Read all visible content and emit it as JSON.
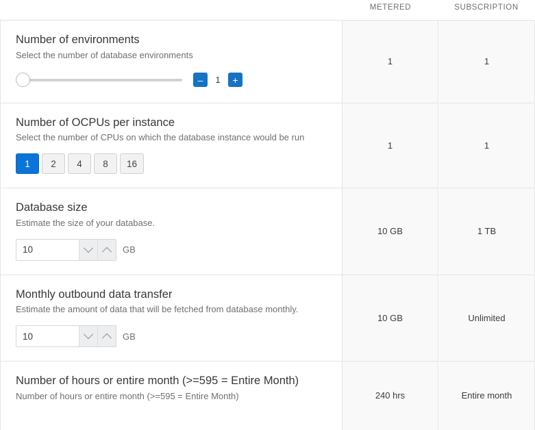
{
  "columns": [
    {
      "id": "metered",
      "label": "METERED"
    },
    {
      "id": "subscription",
      "label": "SUBSCRIPTION"
    }
  ],
  "colors": {
    "accent_blue": "#1573c4",
    "selected_blue": "#0a74d8",
    "value_cell_bg": "#f9f9f9",
    "border": "#e4e4e4",
    "title_text": "#383838",
    "desc_text": "#6f6f6f"
  },
  "rows": [
    {
      "id": "number-of-environments",
      "title": "Number of environments",
      "description": "Select the number of database environments",
      "control": "slider",
      "slider": {
        "value": "1",
        "decrement_label": "–",
        "increment_label": "+",
        "position_percent": 0
      },
      "metered": "1",
      "subscription": "1"
    },
    {
      "id": "number-of-ocpus-per-instance",
      "title": "Number of OCPUs per instance",
      "description": "Select the number of CPUs on which the database instance would be run",
      "control": "segments",
      "segments": [
        {
          "label": "1",
          "selected": true
        },
        {
          "label": "2",
          "selected": false
        },
        {
          "label": "4",
          "selected": false
        },
        {
          "label": "8",
          "selected": false
        },
        {
          "label": "16",
          "selected": false
        }
      ],
      "metered": "1",
      "subscription": "1"
    },
    {
      "id": "database-size",
      "title": "Database size",
      "description": "Estimate the size of your database.",
      "control": "spinner",
      "spinner": {
        "value": "10",
        "placeholder": "10",
        "unit": "GB"
      },
      "metered": "10 GB",
      "subscription": "1 TB"
    },
    {
      "id": "monthly-outbound-data-transfer",
      "title": "Monthly outbound data transfer",
      "description": "Estimate the amount of data that will be fetched from database monthly.",
      "control": "spinner",
      "spinner": {
        "value": "10",
        "placeholder": "10",
        "unit": "GB"
      },
      "metered": "10 GB",
      "subscription": "Unlimited"
    },
    {
      "id": "number-of-hours-or-entire-month",
      "title": "Number of hours or entire month (>=595 = Entire Month)",
      "description": "Number of hours or entire month (>=595 = Entire Month)",
      "control": "none",
      "metered": "240 hrs",
      "subscription": "Entire month"
    }
  ]
}
